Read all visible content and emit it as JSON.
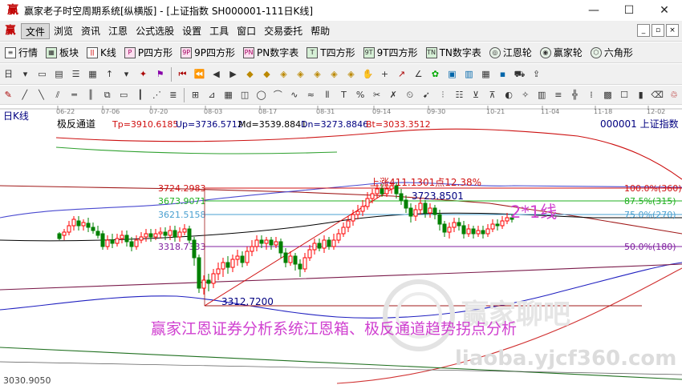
{
  "window": {
    "title": "赢家老子时空周期系统[纵横版] - [上证指数  SH000001-111日K线]",
    "btn_min": "—",
    "btn_max": "☐",
    "btn_close": "✕"
  },
  "menu": {
    "logo": "赢",
    "items": [
      "文件",
      "浏览",
      "资讯",
      "江恩",
      "公式选股",
      "设置",
      "工具",
      "窗口",
      "交易委托",
      "帮助"
    ]
  },
  "toolbar1": {
    "items": [
      {
        "label": "行情",
        "icon": "quote-icon"
      },
      {
        "label": "板块",
        "icon": "sector-icon"
      },
      {
        "label": "K线",
        "icon": "candle-icon"
      },
      {
        "label": "P四方形",
        "icon": "P"
      },
      {
        "label": "9P四方形",
        "icon": "9P"
      },
      {
        "label": "PN数字表",
        "icon": "PN"
      },
      {
        "label": "T四方形",
        "icon": "T"
      },
      {
        "label": "9T四方形",
        "icon": "9T"
      },
      {
        "label": "TN数字表",
        "icon": "TN"
      },
      {
        "label": "江恩轮",
        "icon": "gann-wheel-icon"
      },
      {
        "label": "赢家轮",
        "icon": "winner-wheel-icon"
      },
      {
        "label": "六角形",
        "icon": "hexagon-icon"
      }
    ]
  },
  "toolbar2": {
    "period_label": "日",
    "arrow_label": "↑"
  },
  "chart": {
    "period_label": "日K线",
    "indicator_name": "极反通道",
    "tp": "Tp=3910.6185",
    "up": "Up=3736.5712",
    "md": "Md=3539.8841",
    "dn": "Dn=3273.8846",
    "bt": "Bt=3033.3512",
    "stock": "000001  上证指数",
    "dates": [
      "06-22",
      "07-06",
      "07-20",
      "08-03",
      "08-17",
      "08-31",
      "09-14",
      "09-30",
      "10-21",
      "11-04",
      "11-18",
      "12-02"
    ],
    "levels": [
      {
        "value": "3724.2983",
        "right": "100.0%(360)",
        "color": "#d01010"
      },
      {
        "value": "3673.9071",
        "right": "87.5%(315)",
        "color": "#20b020"
      },
      {
        "value": "3621.5158",
        "right": "75.0%(270)",
        "color": "#4aa0d0"
      },
      {
        "value": "3318.7333",
        "right": "50.0%(180)",
        "color": "#8020a0"
      }
    ],
    "low_label": "3312.7200",
    "high_label": "3723.8501",
    "rise_label": "上涨411.1301点12.38%",
    "annot_21": "2*1线",
    "watermark_title": "赢家江恩证券分析系统江恩箱、极反通道趋势拐点分析",
    "watermark_site": "liaoba.yjcf360.com",
    "watermark_brand": "赢家聊吧",
    "bottom_value": "3030.9050",
    "colors": {
      "up": "#ff0000",
      "down": "#008000",
      "pink": "#d040d0"
    }
  }
}
